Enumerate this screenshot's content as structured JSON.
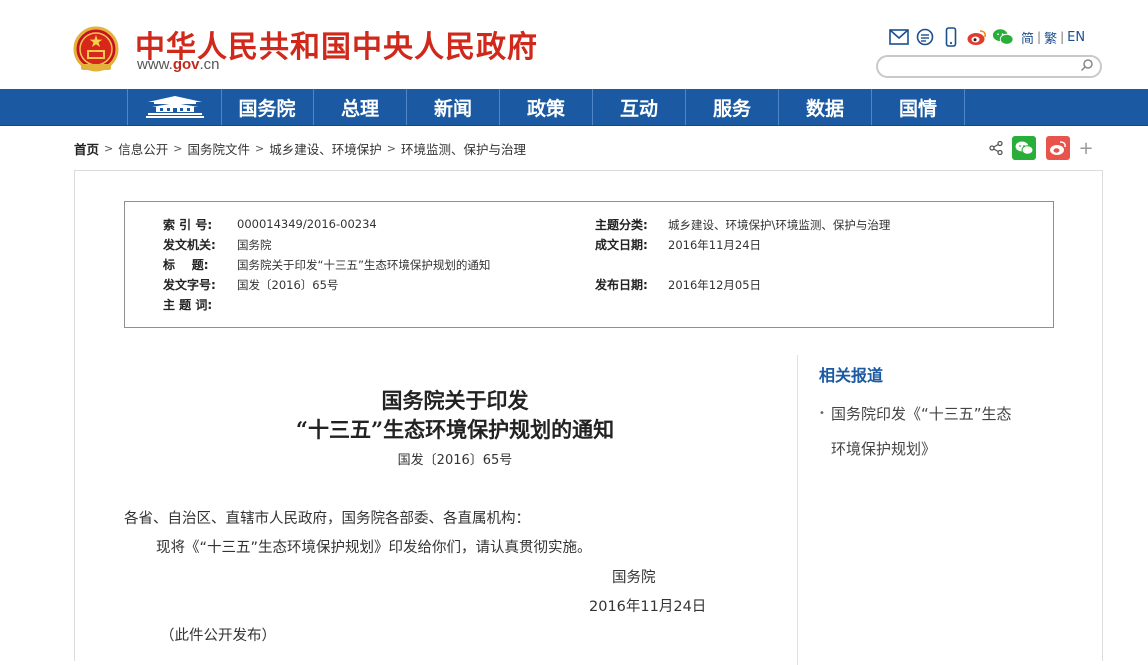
{
  "header": {
    "site_title": "中华人民共和国中央人民政府",
    "url_pre": "www.",
    "url_mid": "gov",
    "url_post": ".cn",
    "icons": [
      "mail-icon",
      "note-icon",
      "mobile-icon",
      "weibo-icon",
      "wechat-icon"
    ],
    "lang_simplified": "简",
    "lang_traditional": "繁",
    "lang_english": "EN",
    "lang_sep": "|",
    "search_placeholder": ""
  },
  "nav": {
    "items": [
      "国务院",
      "总理",
      "新闻",
      "政策",
      "互动",
      "服务",
      "数据",
      "国情"
    ]
  },
  "breadcrumb": {
    "sep": ">",
    "items": [
      "首页",
      "信息公开",
      "国务院文件",
      "城乡建设、环境保护",
      "环境监测、保护与治理"
    ]
  },
  "share": {
    "more_label": "+"
  },
  "meta": {
    "index_label": "索 引 号:",
    "index_value": "000014349/2016-00234",
    "category_label": "主题分类:",
    "category_value": "城乡建设、环境保护\\环境监测、保护与治理",
    "issuer_label": "发文机关:",
    "issuer_value": "国务院",
    "date_created_label": "成文日期:",
    "date_created_value": "2016年11月24日",
    "title_label": "标    题:",
    "title_value": "国务院关于印发“十三五”生态环境保护规划的通知",
    "doc_no_label": "发文字号:",
    "doc_no_value": "国发〔2016〕65号",
    "publish_label": "发布日期:",
    "publish_value": "2016年12月05日",
    "keywords_label": "主 题 词:",
    "keywords_value": ""
  },
  "document": {
    "title_line1": "国务院关于印发",
    "title_line2": "“十三五”生态环境保护规划的通知",
    "number": "国发〔2016〕65号",
    "salutation": "各省、自治区、直辖市人民政府，国务院各部委、各直属机构：",
    "paragraph1": "现将《“十三五”生态环境保护规划》印发给你们，请认真贯彻实施。",
    "signature": "国务院",
    "date": "2016年11月24日",
    "public_note": "（此件公开发布）"
  },
  "related": {
    "title": "相关报道",
    "items": [
      "国务院印发《“十三五”生态",
      "环境保护规划》"
    ]
  },
  "colors": {
    "brand_red": "#d0281a",
    "nav_blue": "#1b5aa2",
    "wechat_green": "#2aae3a",
    "weibo_orange": "#e8544b"
  }
}
